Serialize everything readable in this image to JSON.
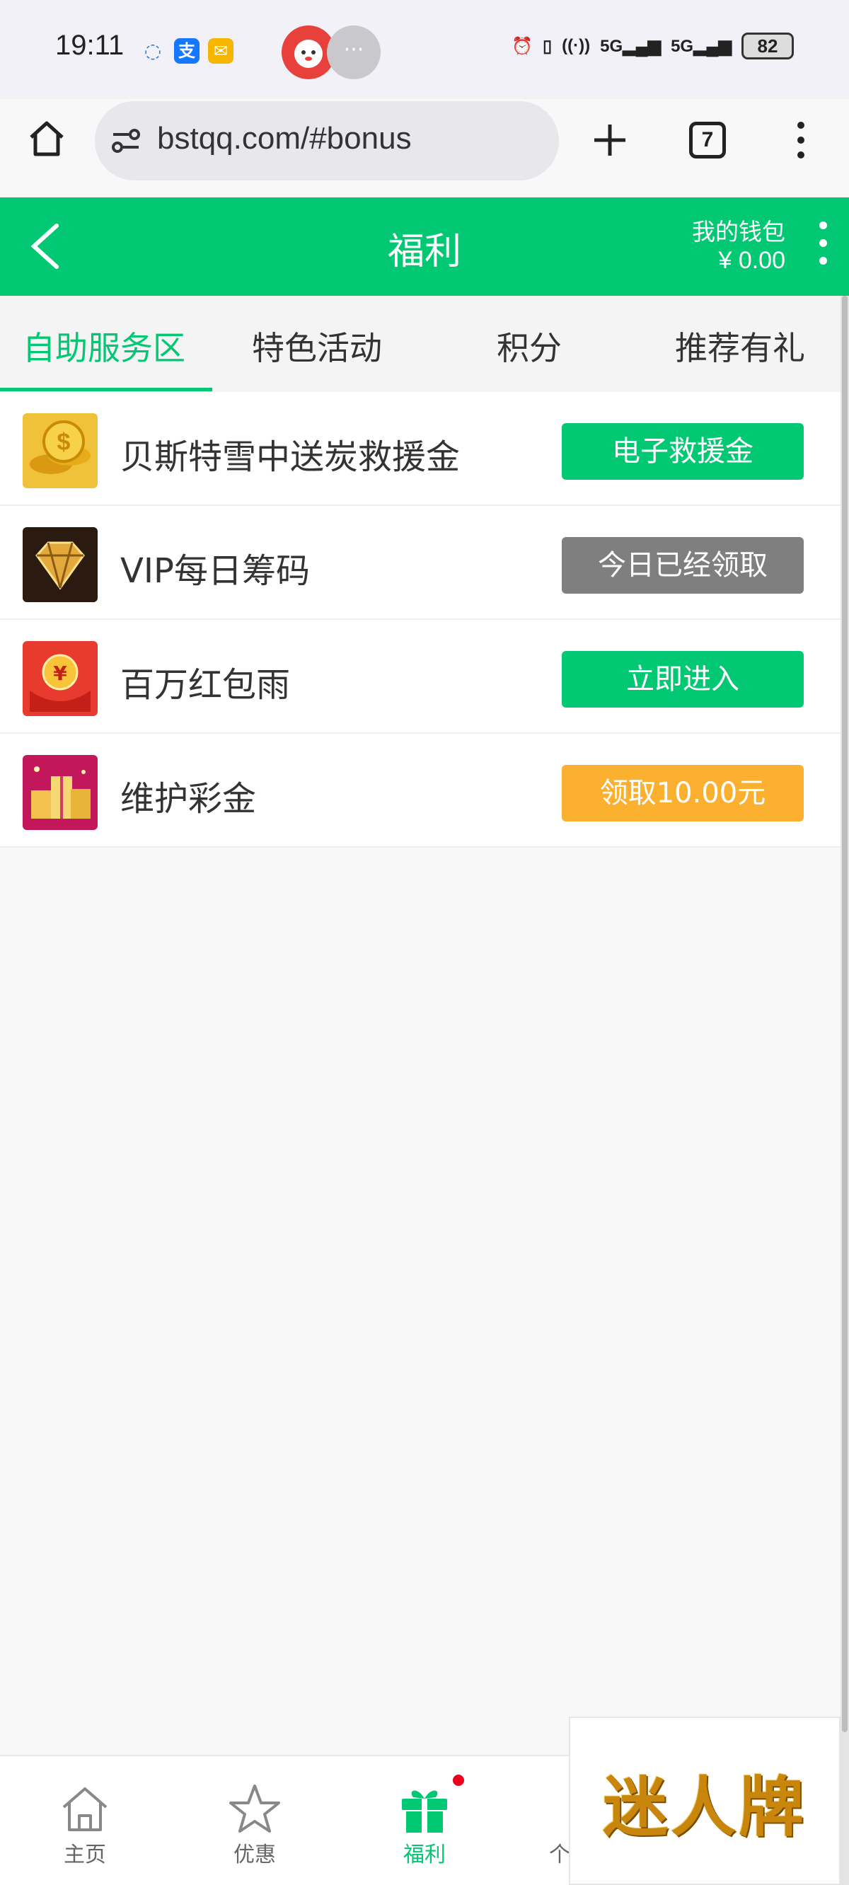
{
  "status_bar": {
    "time": "19:11",
    "battery": "82",
    "network": "5G"
  },
  "browser": {
    "url": "bstqq.com/#bonus",
    "tab_count": "7"
  },
  "header": {
    "title": "福利",
    "wallet_label": "我的钱包",
    "wallet_amount": "¥ 0.00"
  },
  "tabs": [
    {
      "label": "自助服务区",
      "active": true
    },
    {
      "label": "特色活动",
      "active": false
    },
    {
      "label": "积分",
      "active": false
    },
    {
      "label": "推荐有礼",
      "active": false
    }
  ],
  "items": [
    {
      "label": "贝斯特雪中送炭救援金",
      "button": "电子救援金",
      "button_color": "#02c873",
      "icon": "gold-coins-icon"
    },
    {
      "label": "VIP每日筹码",
      "button": "今日已经领取",
      "button_color": "#7f7f7f",
      "icon": "diamond-icon"
    },
    {
      "label": "百万红包雨",
      "button": "立即进入",
      "button_color": "#02c873",
      "icon": "red-envelope-icon"
    },
    {
      "label": "维护彩金",
      "button": "领取10.00元",
      "button_color": "#fbb02f",
      "icon": "gift-boxes-icon"
    }
  ],
  "bottom_nav": [
    {
      "label": "主页",
      "icon": "home-icon"
    },
    {
      "label": "优惠",
      "icon": "star-icon"
    },
    {
      "label": "福利",
      "icon": "gift-icon",
      "active": true
    },
    {
      "label": "个",
      "icon": "person-icon"
    }
  ],
  "ad": {
    "text": "迷人牌"
  },
  "colors": {
    "accent": "#02c873",
    "disabled": "#7f7f7f",
    "warning": "#fbb02f"
  }
}
